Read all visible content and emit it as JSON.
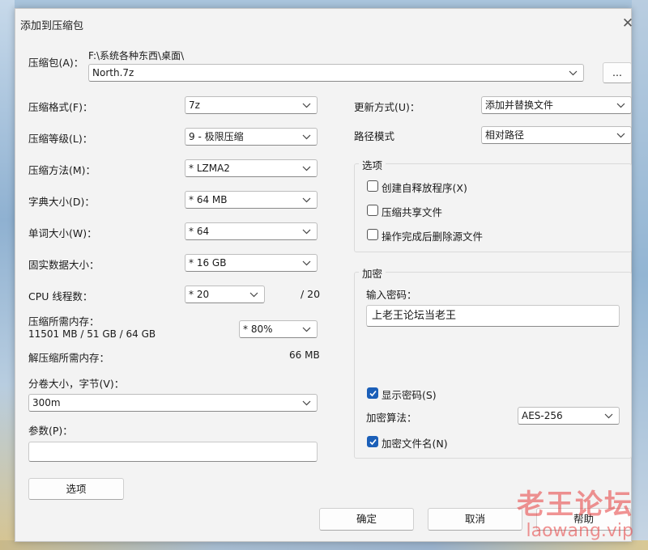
{
  "window": {
    "title": "添加到压缩包",
    "close_symbol": "✕"
  },
  "archive": {
    "label": "压缩包(A)：",
    "path": "F:\\系统各种东西\\桌面\\",
    "name": "North.7z",
    "browse_label": "..."
  },
  "left": {
    "format": {
      "label": "压缩格式(F)：",
      "value": "7z"
    },
    "level": {
      "label": "压缩等级(L)：",
      "value": "9 - 极限压缩"
    },
    "method": {
      "label": "压缩方法(M)：",
      "value": "* LZMA2"
    },
    "dict": {
      "label": "字典大小(D)：",
      "value": "* 64 MB"
    },
    "word": {
      "label": "单词大小(W)：",
      "value": "* 64"
    },
    "solid": {
      "label": "固实数据大小：",
      "value": "* 16 GB"
    },
    "threads": {
      "label": "CPU 线程数：",
      "value": "* 20",
      "max": "/ 20"
    },
    "mem_compress": {
      "label": "压缩所需内存：",
      "detail": "11501 MB / 51 GB / 64 GB",
      "value": "* 80%"
    },
    "mem_decompress": {
      "label": "解压缩所需内存：",
      "value": "66 MB"
    },
    "volume": {
      "label": "分卷大小，字节(V)：",
      "value": "300m"
    },
    "params": {
      "label": "参数(P)：",
      "value": ""
    },
    "options_button": "选项"
  },
  "right": {
    "update_mode": {
      "label": "更新方式(U)：",
      "value": "添加并替换文件"
    },
    "path_mode": {
      "label": "路径模式",
      "value": "相对路径"
    },
    "options_group": {
      "title": "选项",
      "sfx": {
        "label": "创建自释放程序(X)",
        "checked": false
      },
      "shared": {
        "label": "压缩共享文件",
        "checked": false
      },
      "delete_after": {
        "label": "操作完成后删除源文件",
        "checked": false
      }
    },
    "encryption_group": {
      "title": "加密",
      "password_label": "输入密码：",
      "password_value": "上老王论坛当老王",
      "show_password": {
        "label": "显示密码(S)",
        "checked": true
      },
      "method_label": "加密算法：",
      "method_value": "AES-256",
      "encrypt_names": {
        "label": "加密文件名(N)",
        "checked": true
      }
    }
  },
  "footer": {
    "ok": "确定",
    "cancel": "取消",
    "help": "帮助"
  },
  "watermark": {
    "cn": "老王论坛",
    "en": "laowang.vip"
  },
  "colors": {
    "dialog_bg": "#f3f3f3",
    "accent": "#1b5fb8",
    "watermark": "#e63c3c"
  },
  "icons": {
    "dropdown": "chevron-down-icon",
    "check": "checkmark-icon",
    "close": "close-icon"
  }
}
